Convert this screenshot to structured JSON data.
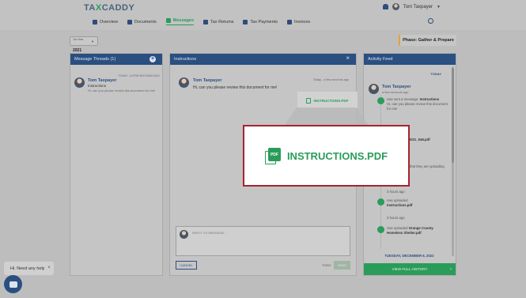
{
  "brand": {
    "logo_pre": "TA",
    "logo_x": "X",
    "logo_post": "CADDY"
  },
  "user": {
    "name": "Tom Taxpayer"
  },
  "nav": [
    {
      "label": "Overview"
    },
    {
      "label": "Documents"
    },
    {
      "label": "Messages"
    },
    {
      "label": "Tax Returns"
    },
    {
      "label": "Tax Payments"
    },
    {
      "label": "Invoices"
    }
  ],
  "year": {
    "label": "Tax Year",
    "value": "2021"
  },
  "phase": "Phase: Gather & Prepare",
  "threads": {
    "title": "Message Threads (1)",
    "items": [
      {
        "name": "Tom Taxpayer",
        "time": "TODAY - A FEW SECONDS AGO",
        "subject": "Instructions",
        "preview": "Hi, can you please review this document for me!"
      }
    ]
  },
  "instructions": {
    "title": "Instructions",
    "message": {
      "name": "Tom Taxpayer",
      "time": "Today - a few seconds ago",
      "body": "Hi, can you please review this document for me!"
    },
    "attachment": "INSTRUCTIONS.PDF",
    "attachment_icon": "PDF",
    "reply_placeholder": "REPLY TO MESSAGE...",
    "cancel_label": "CANCEL",
    "todo_label": "TODO",
    "send_label": "SEND"
  },
  "activity": {
    "title": "Activity Feed",
    "today_label": "TODAY",
    "person": {
      "name": "Tom Taxpayer",
      "ago": "a few seconds ago"
    },
    "entries": [
      {
        "text": "Has sent a message:",
        "bold": "Instructions",
        "extra": "Hi, can you please review this document for me!"
      },
      {
        "text": "Has uploaded",
        "bold": "2021_546.pdf",
        "extra": ""
      },
      {
        "text": "Has confirmed that they are uploading documents for",
        "bold": "",
        "extra": ""
      },
      {
        "text": "3 hours ago",
        "bold": "",
        "extra": ""
      },
      {
        "text": "Has uploaded",
        "bold": "Instructions.pdf",
        "extra": ""
      },
      {
        "text": "3 hours ago",
        "bold": "",
        "extra": ""
      },
      {
        "text": "Has uploaded",
        "bold": "Orange County Homeless Shelter.pdf",
        "extra": ""
      }
    ],
    "date_label": "TUESDAY, DECEMBER 6, 2022",
    "view_history": "VIEW FULL HISTORY"
  },
  "help": {
    "text": "Hi. Need any help?"
  },
  "colors": {
    "navy": "#2a4f81",
    "green": "#2a9c5a",
    "highlight": "#a4242c"
  }
}
